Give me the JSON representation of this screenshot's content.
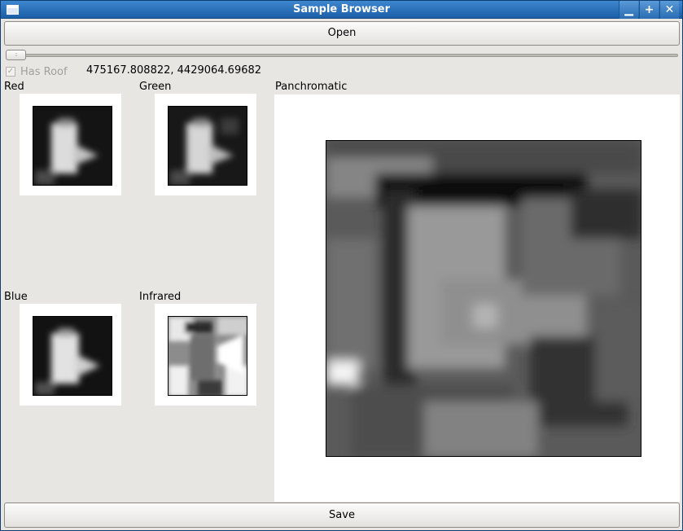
{
  "window": {
    "title": "Sample Browser"
  },
  "toolbar": {
    "open_label": "Open"
  },
  "slider": {
    "handle_glyph": "::",
    "value": 0
  },
  "roof": {
    "label": "Has Roof",
    "checked": true,
    "coords": "475167.808822, 4429064.69682"
  },
  "bands": {
    "red": "Red",
    "green": "Green",
    "blue": "Blue",
    "infrared": "Infrared",
    "panchromatic": "Panchromatic"
  },
  "footer": {
    "save_label": "Save"
  },
  "icons": {
    "minimize": "▁",
    "maximize": "+",
    "close": "✕",
    "check": "✓"
  }
}
